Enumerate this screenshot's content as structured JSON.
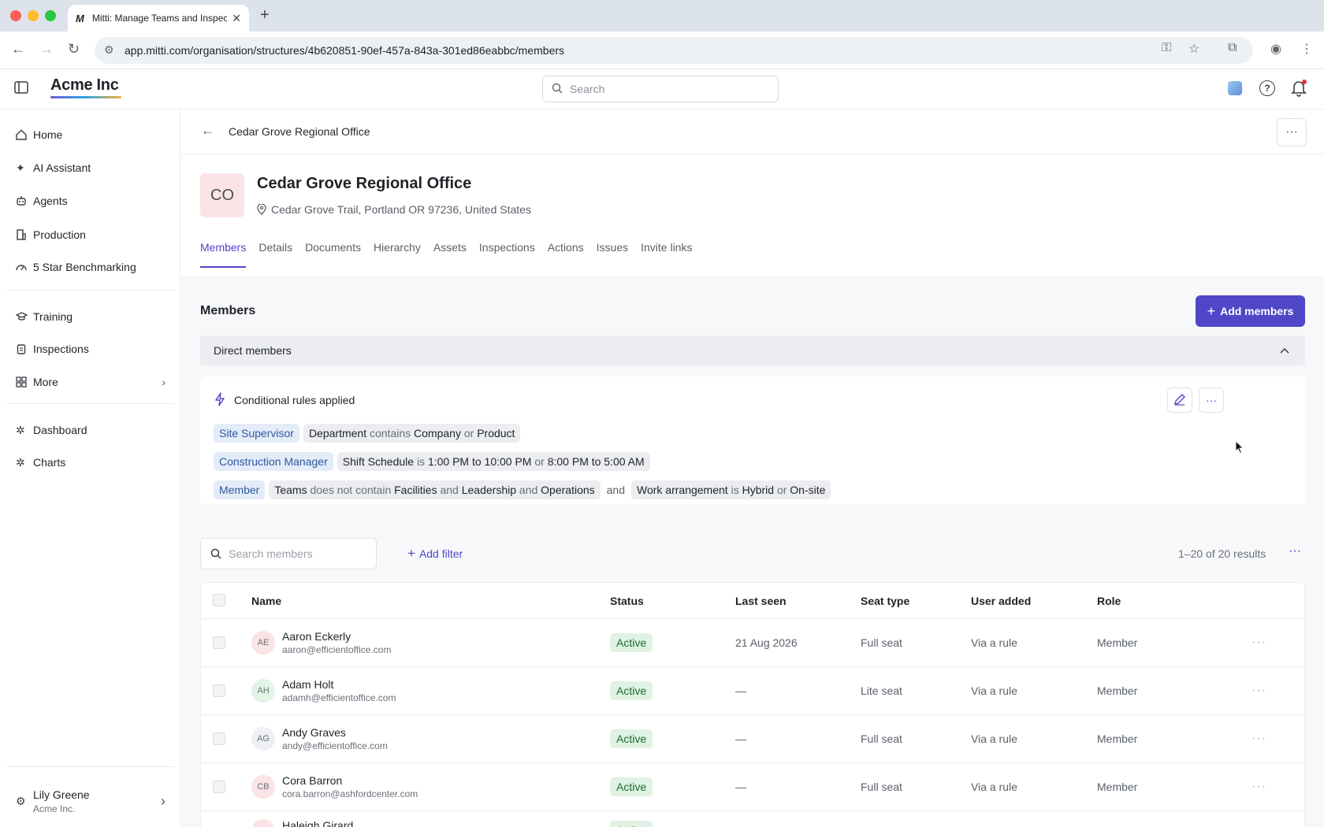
{
  "browser": {
    "tab_title": "Mitti: Manage Teams and Inspections",
    "favicon": "M",
    "url": "app.mitti.com/organisation/structures/4b620851-90ef-457a-843a-301ed86eabbc/members"
  },
  "header": {
    "brand": "Acme Inc",
    "search_placeholder": "Search"
  },
  "sidebar": {
    "items": [
      {
        "label": "Home",
        "icon": "home-icon"
      },
      {
        "label": "AI Assistant",
        "icon": "sparkle-icon"
      },
      {
        "label": "Agents",
        "icon": "robot-icon"
      },
      {
        "label": "Production",
        "icon": "building-icon"
      },
      {
        "label": "5 Star Benchmarking",
        "icon": "gauge-icon"
      },
      {
        "label": "Training",
        "icon": "graduation-cap-icon"
      },
      {
        "label": "Inspections",
        "icon": "clipboard-icon"
      },
      {
        "label": "More",
        "icon": "grid-icon"
      },
      {
        "label": "Dashboard",
        "icon": "puzzle-icon"
      },
      {
        "label": "Charts",
        "icon": "puzzle-icon"
      }
    ],
    "user": {
      "name": "Lily Greene",
      "org": "Acme Inc."
    }
  },
  "page": {
    "breadcrumb": "Cedar Grove Regional Office",
    "initials": "CO",
    "title": "Cedar Grove Regional Office",
    "address": "Cedar Grove Trail, Portland OR 97236, United States",
    "tabs": [
      "Members",
      "Details",
      "Documents",
      "Hierarchy",
      "Assets",
      "Inspections",
      "Actions",
      "Issues",
      "Invite links"
    ]
  },
  "members": {
    "heading": "Members",
    "add_button": "Add members",
    "section": "Direct members",
    "rules_title": "Conditional rules applied",
    "rules": {
      "r1": {
        "role": "Site Supervisor",
        "field": "Department",
        "op": "contains",
        "v1": "Company",
        "or": "or",
        "v2": "Product"
      },
      "r2": {
        "role": "Construction Manager",
        "field": "Shift Schedule",
        "op": "is",
        "v1": "1:00 PM to 10:00 PM",
        "or": "or",
        "v2": "8:00 PM to 5:00 AM"
      },
      "r3": {
        "role": "Member",
        "field": "Teams",
        "op": "does not contain",
        "v1": "Facilities",
        "and1": "and",
        "v2": "Leadership",
        "and2": "and",
        "v3": "Operations",
        "joiner": "and",
        "field2": "Work arrangement",
        "op2": "is",
        "v4": "Hybrid",
        "or": "or",
        "v5": "On-site"
      }
    },
    "search_placeholder": "Search members",
    "add_filter": "Add filter",
    "results": "1–20 of 20 results",
    "columns": {
      "name": "Name",
      "status": "Status",
      "last_seen": "Last seen",
      "seat_type": "Seat type",
      "user_added": "User added",
      "role": "Role"
    },
    "rows": [
      {
        "initials": "AE",
        "name": "Aaron Eckerly",
        "email": "aaron@efficientoffice.com",
        "status": "Active",
        "last_seen": "21 Aug 2026",
        "seat": "Full seat",
        "added": "Via a rule",
        "role": "Member",
        "avatar_bg": "#fbe4e6"
      },
      {
        "initials": "AH",
        "name": "Adam Holt",
        "email": "adamh@efficientoffice.com",
        "status": "Active",
        "last_seen": "—",
        "seat": "Lite seat",
        "added": "Via a rule",
        "role": "Member",
        "avatar_bg": "#e2f4e6"
      },
      {
        "initials": "AG",
        "name": "Andy Graves",
        "email": "andy@efficientoffice.com",
        "status": "Active",
        "last_seen": "—",
        "seat": "Full seat",
        "added": "Via a rule",
        "role": "Member",
        "avatar_bg": "#eef0f3"
      },
      {
        "initials": "CB",
        "name": "Cora Barron",
        "email": "cora.barron@ashfordcenter.com",
        "status": "Active",
        "last_seen": "—",
        "seat": "Full seat",
        "added": "Via a rule",
        "role": "Member",
        "avatar_bg": "#fbe4e6"
      },
      {
        "initials": "HG",
        "name": "Haleigh Girard",
        "email": "",
        "status": "Active",
        "last_seen": "",
        "seat": "",
        "added": "",
        "role": "",
        "avatar_bg": "#fbe4e6"
      }
    ]
  },
  "colors": {
    "accent": "#4f46c8",
    "active_bg": "#dff2e3",
    "role_pill": "#e3ecf8"
  }
}
